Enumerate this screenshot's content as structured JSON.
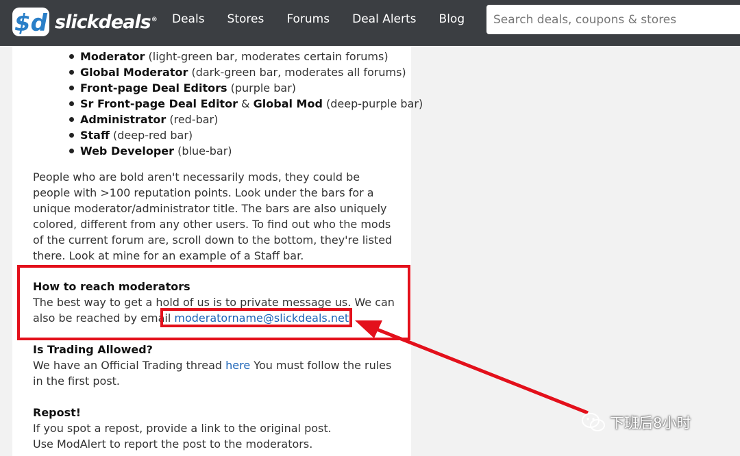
{
  "header": {
    "logo_mark": "$d",
    "logo_text": "slickdeals",
    "logo_reg": "®",
    "nav": [
      "Deals",
      "Stores",
      "Forums",
      "Deal Alerts",
      "Blog"
    ],
    "search_placeholder": "Search deals, coupons & stores"
  },
  "roles": [
    {
      "name": "Moderator",
      "desc": " (light-green bar, moderates certain forums)"
    },
    {
      "name": "Global Moderator",
      "desc": " (dark-green bar, moderates all forums)"
    },
    {
      "name": "Front-page Deal Editors",
      "desc": " (purple bar)"
    },
    {
      "name": "Sr Front-page Deal Editor",
      "amp": " & ",
      "name2": "Global Mod",
      "desc": " (deep-purple bar)"
    },
    {
      "name": "Administrator",
      "desc": " (red-bar)"
    },
    {
      "name": "Staff",
      "desc": " (deep-red bar)"
    },
    {
      "name": "Web Developer",
      "desc": " (blue-bar)"
    }
  ],
  "bold_paragraph": "People who are bold aren't necessarily mods, they could be people with >100 reputation points. Look under the bars for a unique moderator/administrator title. The bars are also uniquely colored, different from any other users. To find out who the mods of the current forum are, scroll down to the bottom, they're listed there. Look at mine for an example of a Staff bar.",
  "reach": {
    "title": "How to reach moderators",
    "text": "The best way to get a hold of us is to private message us. We can also be reached by email ",
    "email": "moderatorname@slickdeals.net"
  },
  "trading": {
    "title": "Is Trading Allowed?",
    "text_before": "We have an Official Trading thread ",
    "link": "here",
    "text_after": " You must follow the rules in the first post."
  },
  "repost": {
    "title": "Repost!",
    "line1": "If you spot a repost, provide a link to the original post.",
    "line2": "Use ModAlert to report the post to the moderators."
  },
  "watermark": "下班后8小时",
  "colors": {
    "header_bg": "#3b3e42",
    "annotation_red": "#e3101b",
    "link_blue": "#1a63b7",
    "logo_blue": "#2a7fc8"
  }
}
